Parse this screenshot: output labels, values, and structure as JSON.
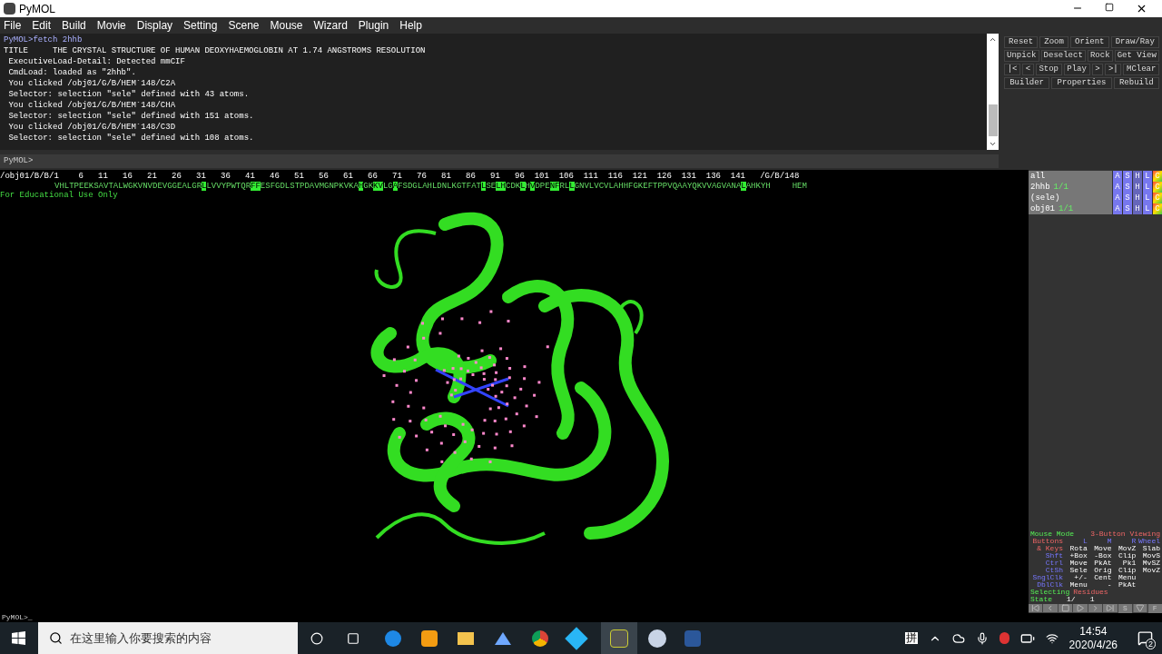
{
  "window": {
    "title": "PyMOL"
  },
  "menu": [
    "File",
    "Edit",
    "Build",
    "Movie",
    "Display",
    "Setting",
    "Scene",
    "Mouse",
    "Wizard",
    "Plugin",
    "Help"
  ],
  "console": {
    "lines": [
      {
        "kind": "prompt",
        "text": "PyMOL>fetch 2hhb"
      },
      {
        "kind": "output",
        "text": "TITLE     THE CRYSTAL STRUCTURE OF HUMAN DEOXYHAEMOGLOBIN AT 1.74 ANGSTROMS RESOLUTION"
      },
      {
        "kind": "output",
        "text": " ExecutiveLoad-Detail: Detected mmCIF"
      },
      {
        "kind": "output",
        "text": " CmdLoad: loaded as \"2hhb\"."
      },
      {
        "kind": "output",
        "text": " You clicked /obj01/G/B/HEM`148/C2A"
      },
      {
        "kind": "output",
        "text": " Selector: selection \"sele\" defined with 43 atoms."
      },
      {
        "kind": "output",
        "text": " You clicked /obj01/G/B/HEM`148/CHA"
      },
      {
        "kind": "output",
        "text": " Selector: selection \"sele\" defined with 151 atoms."
      },
      {
        "kind": "output",
        "text": " You clicked /obj01/G/B/HEM`148/C3D"
      },
      {
        "kind": "output",
        "text": " Selector: selection \"sele\" defined with 108 atoms."
      }
    ]
  },
  "command": {
    "prompt": "PyMOL>"
  },
  "buttons": [
    [
      "Reset",
      "Zoom",
      "Orient",
      "Draw/Ray"
    ],
    [
      "Unpick",
      "Deselect",
      "Rock",
      "Get View"
    ],
    [
      "|<",
      "<",
      "Stop",
      "Play",
      ">",
      ">|",
      "MClear"
    ],
    [
      "Builder",
      "Properties",
      "Rebuild"
    ]
  ],
  "sequence": {
    "header": "/obj01/B/B/1    6   11   16   21   26   31   36   41   46   51   56   61   66   71   76   81   86   91   96  101  106  111  116  121  126  131  136  141   /G/B/148",
    "segments": [
      {
        "text": "VHLTPEEKSAVTALWGKVNVDEVGGEALGR",
        "selected": false
      },
      {
        "text": "L",
        "selected": true
      },
      {
        "text": "LVVYPWTQR",
        "selected": false
      },
      {
        "text": "FF",
        "selected": true
      },
      {
        "text": "ESFGDLSTPDAVMGNPKVKA",
        "selected": false
      },
      {
        "text": "H",
        "selected": true
      },
      {
        "text": "GK",
        "selected": false
      },
      {
        "text": "KV",
        "selected": true
      },
      {
        "text": "LG",
        "selected": false
      },
      {
        "text": "A",
        "selected": true
      },
      {
        "text": "FSDGLAHLDNLKGTFAT",
        "selected": false
      },
      {
        "text": "L",
        "selected": true
      },
      {
        "text": "SE",
        "selected": false
      },
      {
        "text": "LH",
        "selected": true
      },
      {
        "text": "CDK",
        "selected": false
      },
      {
        "text": "L",
        "selected": true
      },
      {
        "text": "H",
        "selected": false
      },
      {
        "text": "V",
        "selected": true
      },
      {
        "text": "DPE",
        "selected": false
      },
      {
        "text": "NF",
        "selected": true
      },
      {
        "text": "RL",
        "selected": false
      },
      {
        "text": "L",
        "selected": true
      },
      {
        "text": "GNVLVCVLAHHFGKEFTPPVQAAYQKVVAGVANA",
        "selected": false
      },
      {
        "text": "L",
        "selected": true
      },
      {
        "text": "AHKYH",
        "selected": false
      }
    ],
    "ligand": "HEM"
  },
  "viewer": {
    "notice": "For Educational Use Only"
  },
  "objects": [
    {
      "name": "all",
      "selected": false,
      "buttons": [
        "A",
        "S",
        "H",
        "L",
        "C"
      ]
    },
    {
      "name": "2hhb",
      "state": "1/1",
      "selected": false,
      "buttons": [
        "A",
        "S",
        "H",
        "L",
        "C"
      ]
    },
    {
      "name": "(sele)",
      "selected": false,
      "buttons": [
        "A",
        "S",
        "H",
        "L",
        "C"
      ]
    },
    {
      "name": "obj01",
      "state": "1/1",
      "selected": false,
      "buttons": [
        "A",
        "S",
        "H",
        "L",
        "C"
      ]
    }
  ],
  "mouse_mode": {
    "title": "Mouse Mode",
    "mode": "3-Button Viewing",
    "header": [
      "Buttons",
      "L",
      "M",
      "R",
      "Wheel"
    ],
    "rows": [
      [
        "& Keys",
        "Rota",
        "Move",
        "MovZ",
        "Slab"
      ],
      [
        "Shft",
        "+Box",
        "-Box",
        "Clip",
        "MovS"
      ],
      [
        "Ctrl",
        "Move",
        "PkAt",
        "Pk1",
        "MvSZ"
      ],
      [
        "CtSh",
        "Sele",
        "Orig",
        "Clip",
        "MovZ"
      ],
      [
        "SnglClk",
        "+/-",
        "Cent",
        "Menu"
      ],
      [
        "DblClk",
        "Menu",
        "-",
        "PkAt"
      ]
    ],
    "selecting": "Selecting",
    "selecting_value": "Residues",
    "state_label": "State",
    "state_value": "1/",
    "state_count": "1"
  },
  "movie_controls": [
    "S",
    "F"
  ],
  "bottom_command": {
    "prompt": "PyMOL>_"
  },
  "taskbar": {
    "search_placeholder": "在这里输入你要搜索的内容",
    "ime": "拼",
    "time": "14:54",
    "date": "2020/4/26",
    "notifications": "2"
  }
}
